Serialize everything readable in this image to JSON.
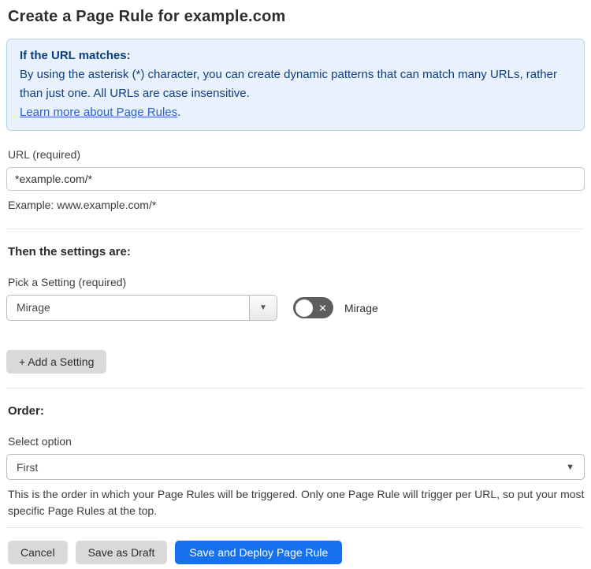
{
  "page": {
    "title": "Create a Page Rule for example.com"
  },
  "info_box": {
    "heading": "If the URL matches:",
    "body": "By using the asterisk (*) character, you can create dynamic patterns that can match many URLs, rather than just one. All URLs are case insensitive.",
    "link_label": "Learn more about Page Rules",
    "link_suffix": "."
  },
  "url_field": {
    "label": "URL (required)",
    "value": "*example.com/*",
    "helper": "Example: www.example.com/*"
  },
  "settings_section": {
    "heading": "Then the settings are:",
    "setting_label": "Pick a Setting (required)",
    "setting_value": "Mirage",
    "toggle": {
      "label": "Mirage",
      "state": "off"
    },
    "add_button_label": "+ Add a Setting"
  },
  "order_section": {
    "heading": "Order:",
    "select_label": "Select option",
    "select_value": "First",
    "helper": "This is the order in which your Page Rules will be triggered. Only one Page Rule will trigger per URL, so put your most specific Page Rules at the top."
  },
  "footer": {
    "cancel_label": "Cancel",
    "save_draft_label": "Save as Draft",
    "save_deploy_label": "Save and Deploy Page Rule"
  },
  "icons": {
    "dropdown_arrow": "▼",
    "toggle_off_glyph": "✕"
  },
  "colors": {
    "primary_blue": "#1672ec",
    "info_background": "#e9f2fc",
    "info_border": "#b5d4f2",
    "info_text": "#0e3e80",
    "link_blue": "#2a61d4",
    "toggle_off_gray": "#5d5d5d",
    "button_gray": "#d9d9d9"
  }
}
